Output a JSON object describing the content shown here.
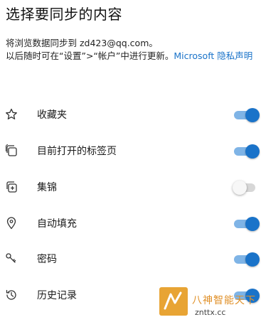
{
  "header": {
    "title": "选择要同步的内容"
  },
  "description": {
    "line1": "将浏览数据同步到 zd423@qq.com。",
    "line2": "以后随时可在“设置”>“帐户”中进行更新。",
    "link": "Microsoft 隐私声明"
  },
  "items": [
    {
      "label": "收藏夹",
      "icon": "star-icon",
      "enabled": true
    },
    {
      "label": "目前打开的标签页",
      "icon": "tabs-icon",
      "enabled": true
    },
    {
      "label": "集锦",
      "icon": "collections-icon",
      "enabled": false
    },
    {
      "label": "自动填充",
      "icon": "location-pin-icon",
      "enabled": true
    },
    {
      "label": "密码",
      "icon": "key-icon",
      "enabled": true
    },
    {
      "label": "历史记录",
      "icon": "history-icon",
      "enabled": true
    }
  ],
  "watermark": {
    "line1": "八神智能天下",
    "line2": "znttx.cc"
  },
  "colors": {
    "accent": "#1a73c9",
    "track_on": "#7fb4e6",
    "track_off": "#d7d7d7"
  }
}
